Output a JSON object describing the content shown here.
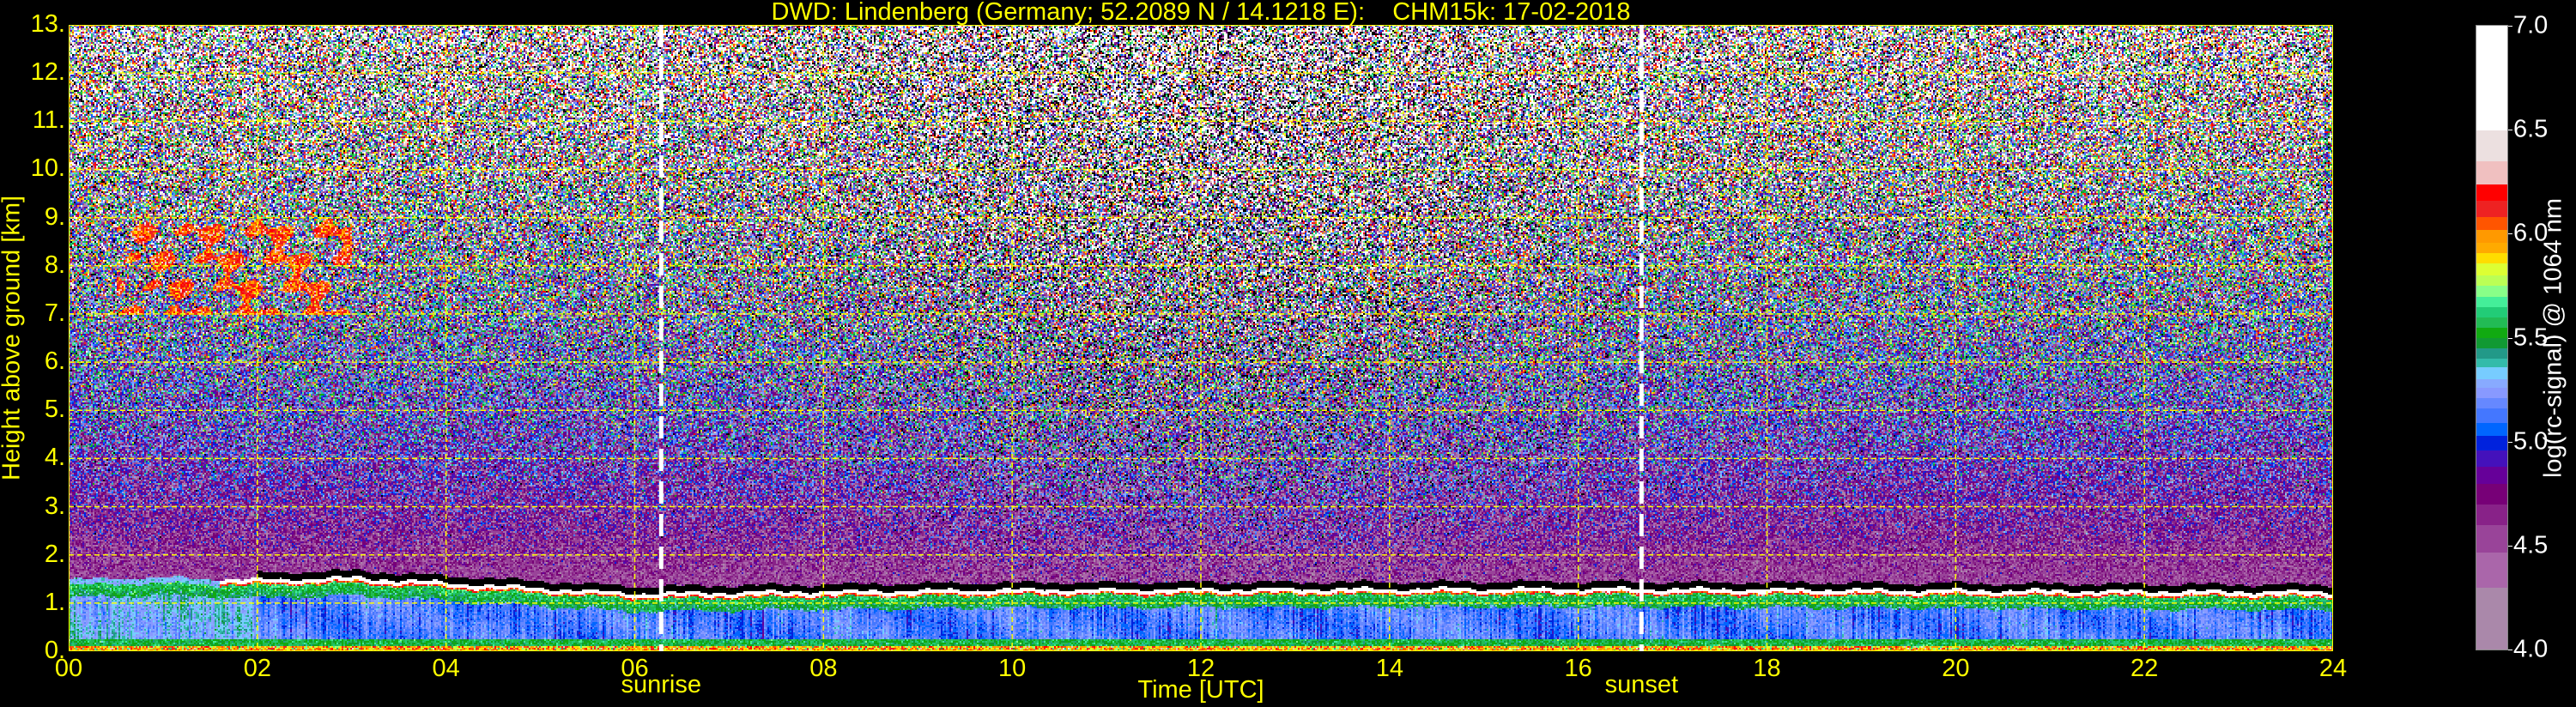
{
  "chart_data": {
    "type": "heatmap",
    "title": "DWD: Lindenberg (Germany; 52.2089 N / 14.1218 E):    CHM15k: 17-02-2018",
    "xlabel": "Time [UTC]",
    "ylabel": "Height above ground [km]",
    "xlim": [
      0,
      24
    ],
    "ylim": [
      0,
      13
    ],
    "grid": true,
    "xticks": [
      0,
      2,
      4,
      6,
      8,
      10,
      12,
      14,
      16,
      18,
      20,
      22,
      24
    ],
    "xtick_labels": [
      "00",
      "02",
      "04",
      "06",
      "08",
      "10",
      "12",
      "14",
      "16",
      "18",
      "20",
      "22",
      "24"
    ],
    "yticks": [
      0,
      1,
      2,
      3,
      4,
      5,
      6,
      7,
      8,
      9,
      10,
      11,
      12,
      13
    ],
    "ytick_labels": [
      "0.",
      "1.",
      "2.",
      "3.",
      "4.",
      "5.",
      "6.",
      "7.",
      "8.",
      "9.",
      "10.",
      "11.",
      "12.",
      "13."
    ],
    "annotations": [
      {
        "label": "sunrise",
        "time": 6.28
      },
      {
        "label": "sunset",
        "time": 16.67
      }
    ],
    "boundary_layer_top_km": {
      "time": [
        0,
        0.8,
        2,
        3,
        6,
        10,
        16,
        24
      ],
      "height": [
        1.5,
        1.55,
        1.5,
        1.55,
        1.22,
        1.3,
        1.32,
        1.25
      ]
    },
    "cirrus": {
      "time_range": [
        0.5,
        3.0
      ],
      "height_range_km": [
        7.0,
        9.0
      ],
      "value": 6.1
    },
    "colorbar": {
      "label": "log(rc-signal) @ 1064 nm",
      "range": [
        4.0,
        7.0
      ],
      "ticks": [
        4.0,
        4.5,
        5.0,
        5.5,
        6.0,
        6.5,
        7.0
      ],
      "tick_labels": [
        "4.0",
        "4.5",
        "5.0",
        "5.5",
        "6.0",
        "6.5",
        "7.0"
      ],
      "levels": [
        4.0,
        4.3,
        4.47,
        4.6,
        4.7,
        4.8,
        4.88,
        4.96,
        5.03,
        5.09,
        5.16,
        5.21,
        5.26,
        5.3,
        5.36,
        5.4,
        5.45,
        5.5,
        5.55,
        5.6,
        5.65,
        5.7,
        5.75,
        5.8,
        5.86,
        5.91,
        5.96,
        6.02,
        6.08,
        6.16,
        6.24,
        6.35,
        6.5,
        7.0
      ],
      "colors": [
        "#aa88aa",
        "#aa66aa",
        "#994499",
        "#882288",
        "#770077",
        "#660099",
        "#4411bb",
        "#0022dd",
        "#0066ff",
        "#4477ff",
        "#6688ff",
        "#8899ff",
        "#88aaff",
        "#77ccff",
        "#33bbaa",
        "#229988",
        "#119933",
        "#11aa11",
        "#22bb55",
        "#22cc77",
        "#44ee99",
        "#88ff88",
        "#bbff55",
        "#ddff33",
        "#ffdd00",
        "#ffaa00",
        "#ff9900",
        "#ff5500",
        "#ee2222",
        "#ff0000",
        "#f0c0c0",
        "#ece0e0",
        "#ffffff"
      ]
    }
  }
}
